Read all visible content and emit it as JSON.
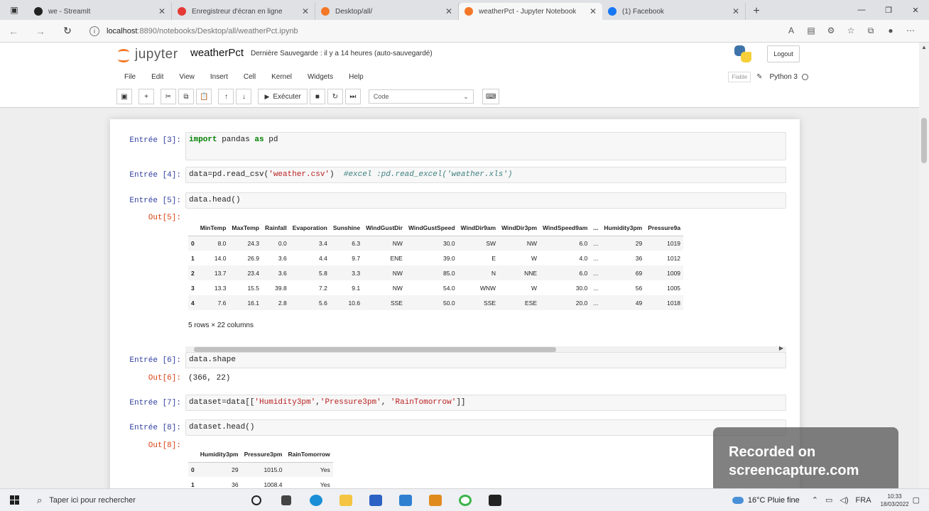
{
  "browser": {
    "tabs": [
      {
        "title": "we - StreamIt",
        "fav_color": "#222222"
      },
      {
        "title": "Enregistreur d'écran en ligne",
        "fav_color": "#e53935"
      },
      {
        "title": "Desktop/all/",
        "fav_color": "#f37726"
      },
      {
        "title": "weatherPct - Jupyter Notebook",
        "fav_color": "#f37726"
      },
      {
        "title": "(1) Facebook",
        "fav_color": "#1877f2"
      }
    ],
    "url_host": "localhost",
    "url_path": ":8890/notebooks/Desktop/all/weatherPct.ipynb"
  },
  "jupyter": {
    "logo_text": "jupyter",
    "notebook_name": "weatherPct",
    "save_status": "Dernière Sauvegarde : il y a 14 heures  (auto-sauvegardé)",
    "logout_label": "Logout",
    "menu": [
      "File",
      "Edit",
      "View",
      "Insert",
      "Cell",
      "Kernel",
      "Widgets",
      "Help"
    ],
    "trusted_label": "Fiable",
    "kernel_name": "Python 3",
    "run_label": "Exécuter",
    "cell_type": "Code"
  },
  "cells": {
    "c3": {
      "prompt": "Entrée [3]:"
    },
    "c4": {
      "prompt": "Entrée [4]:"
    },
    "c5": {
      "prompt": "Entrée [5]:",
      "out_prompt": "Out[5]:",
      "code": "data.head()"
    },
    "c6": {
      "prompt": "Entrée [6]:",
      "out_prompt": "Out[6]:",
      "code": "data.shape",
      "output": "(366, 22)"
    },
    "c7": {
      "prompt": "Entrée [7]:"
    },
    "c8": {
      "prompt": "Entrée [8]:",
      "out_prompt": "Out[8]:",
      "code": "dataset.head()"
    }
  },
  "table1": {
    "columns": [
      "",
      "MinTemp",
      "MaxTemp",
      "Rainfall",
      "Evaporation",
      "Sunshine",
      "WindGustDir",
      "WindGustSpeed",
      "WindDir9am",
      "WindDir3pm",
      "WindSpeed9am",
      "...",
      "Humidity3pm",
      "Pressure9a"
    ],
    "rows": [
      [
        "0",
        "8.0",
        "24.3",
        "0.0",
        "3.4",
        "6.3",
        "NW",
        "30.0",
        "SW",
        "NW",
        "6.0",
        "...",
        "29",
        "1019"
      ],
      [
        "1",
        "14.0",
        "26.9",
        "3.6",
        "4.4",
        "9.7",
        "ENE",
        "39.0",
        "E",
        "W",
        "4.0",
        "...",
        "36",
        "1012"
      ],
      [
        "2",
        "13.7",
        "23.4",
        "3.6",
        "5.8",
        "3.3",
        "NW",
        "85.0",
        "N",
        "NNE",
        "6.0",
        "...",
        "69",
        "1009"
      ],
      [
        "3",
        "13.3",
        "15.5",
        "39.8",
        "7.2",
        "9.1",
        "NW",
        "54.0",
        "WNW",
        "W",
        "30.0",
        "...",
        "56",
        "1005"
      ],
      [
        "4",
        "7.6",
        "16.1",
        "2.8",
        "5.6",
        "10.6",
        "SSE",
        "50.0",
        "SSE",
        "ESE",
        "20.0",
        "...",
        "49",
        "1018"
      ]
    ],
    "dims": "5 rows × 22 columns"
  },
  "table2": {
    "columns": [
      "",
      "Humidity3pm",
      "Pressure3pm",
      "RainTomorrow"
    ],
    "rows": [
      [
        "0",
        "29",
        "1015.0",
        "Yes"
      ],
      [
        "1",
        "36",
        "1008.4",
        "Yes"
      ]
    ]
  },
  "watermark": {
    "line1": "Recorded on",
    "line2": "screencapture.com"
  },
  "taskbar": {
    "search_placeholder": "Taper ici pour rechercher",
    "weather": "16°C  Pluie fine",
    "lang": "FRA",
    "time": "10:33",
    "date": "18/03/2022"
  }
}
